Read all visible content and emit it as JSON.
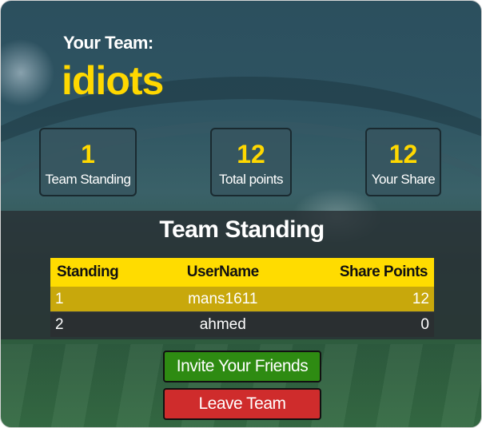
{
  "team": {
    "label": "Your Team:",
    "name": "idiots"
  },
  "stats": [
    {
      "value": "1",
      "label": "Team Standing"
    },
    {
      "value": "12",
      "label": "Total points"
    },
    {
      "value": "12",
      "label": "Your Share"
    }
  ],
  "standings": {
    "title": "Team Standing",
    "headers": {
      "standing": "Standing",
      "username": "UserName",
      "share": "Share Points"
    },
    "rows": [
      {
        "standing": "1",
        "username": "mans1611",
        "share": "12"
      },
      {
        "standing": "2",
        "username": "ahmed",
        "share": "0"
      }
    ]
  },
  "buttons": {
    "invite": "Invite Your Friends",
    "leave": "Leave Team"
  },
  "colors": {
    "accent": "#ffd800",
    "invite": "#2e8b12",
    "leave": "#cf2c2c",
    "highlight_row": "#c8a80c"
  }
}
